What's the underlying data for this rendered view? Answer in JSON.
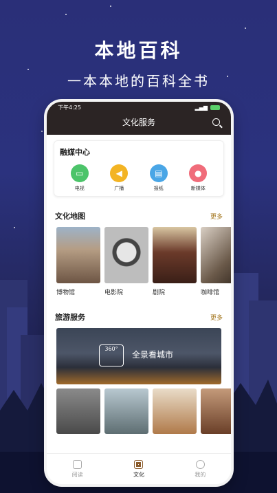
{
  "hero": {
    "title": "本地百科",
    "subtitle": "一本本地的百科全书"
  },
  "status_bar": {
    "time": "下午4:25"
  },
  "header": {
    "title": "文化服务",
    "search_icon": "search-icon"
  },
  "media_center": {
    "title": "融媒中心",
    "items": [
      {
        "label": "电视",
        "icon": "tv-icon",
        "color": "#4cc46a"
      },
      {
        "label": "广播",
        "icon": "broadcast-icon",
        "color": "#f3b424"
      },
      {
        "label": "报纸",
        "icon": "newspaper-icon",
        "color": "#4aa6e6"
      },
      {
        "label": "新媒体",
        "icon": "new-media-icon",
        "color": "#f06c7a"
      }
    ]
  },
  "culture_map": {
    "title": "文化地图",
    "more": "更多",
    "items": [
      {
        "label": "博物馆",
        "color": "#8a7a6a"
      },
      {
        "label": "电影院",
        "color": "#9a9a9a"
      },
      {
        "label": "剧院",
        "color": "#5a3a2a"
      },
      {
        "label": "咖啡馆",
        "color": "#7a6a5a"
      }
    ]
  },
  "tourism": {
    "title": "旅游服务",
    "more": "更多",
    "banner_text": "全景看城市",
    "banner_icon_text": "360°",
    "photos": [
      {
        "color": "#6e6e6e"
      },
      {
        "color": "#7d8b8f"
      },
      {
        "color": "#b07a4a"
      },
      {
        "color": "#8a5a3a"
      }
    ]
  },
  "tabbar": {
    "tabs": [
      {
        "label": "阅读",
        "active": false
      },
      {
        "label": "文化",
        "active": true
      },
      {
        "label": "我的",
        "active": false
      }
    ]
  }
}
